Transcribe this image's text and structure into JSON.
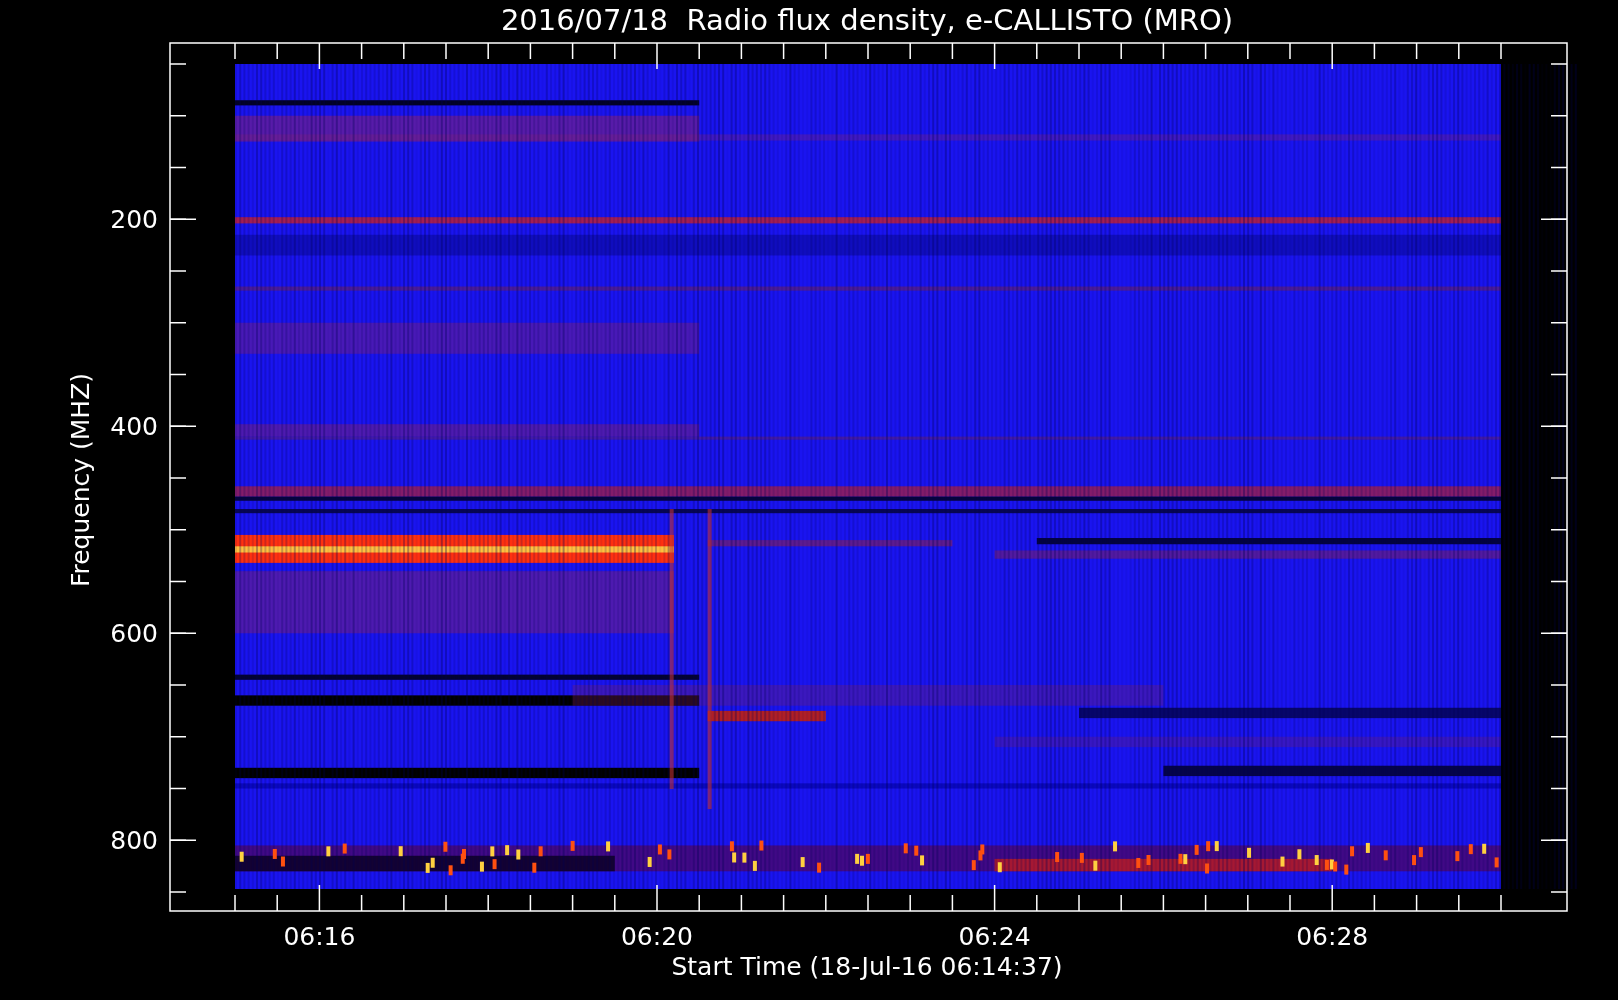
{
  "plot": {
    "title": "2016/07/18  Radio flux density, e-CALLISTO (MRO)",
    "xlabel": "Start Time (18-Jul-16 06:14:37)",
    "ylabel": "Frequency (MHZ)",
    "x_tick_labels": [
      "06:16",
      "06:20",
      "06:24",
      "06:28"
    ],
    "y_tick_labels": [
      "200",
      "400",
      "600",
      "800"
    ]
  }
}
